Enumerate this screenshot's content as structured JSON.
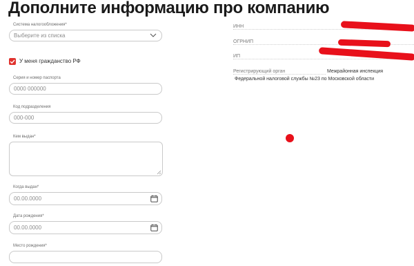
{
  "page": {
    "title": "Дополните информацию про компанию"
  },
  "form": {
    "tax_system": {
      "label": "Система налогообложения*",
      "placeholder": "Выберите из списка"
    },
    "citizenship_checkbox": {
      "label": "У меня гражданство РФ",
      "checked": true
    },
    "passport": {
      "label": "Серия и номер паспорта",
      "placeholder": "0000 000000"
    },
    "division_code": {
      "label": "Код подразделения",
      "placeholder": "000-000"
    },
    "issued_by": {
      "label": "Кем выдан*"
    },
    "issue_date": {
      "label": "Когда выдан*",
      "placeholder": "00.00.0000"
    },
    "birth_date": {
      "label": "Дата рождения*",
      "placeholder": "00.00.0000"
    },
    "birth_place": {
      "label": "Место рождения*"
    }
  },
  "company_info": {
    "inn_label": "ИНН",
    "ogrnip_label": "ОГРНИП",
    "ip_label": "ИП",
    "reg_org_label": "Регистрирующий орган",
    "reg_org_value_line1": "Межрайонная инспекция",
    "reg_org_value_line2": "Федеральной налоговой службы №23 по Московской области"
  },
  "colors": {
    "accent": "#e0322d",
    "redaction": "#e8101a",
    "border": "#c9c9c9"
  }
}
